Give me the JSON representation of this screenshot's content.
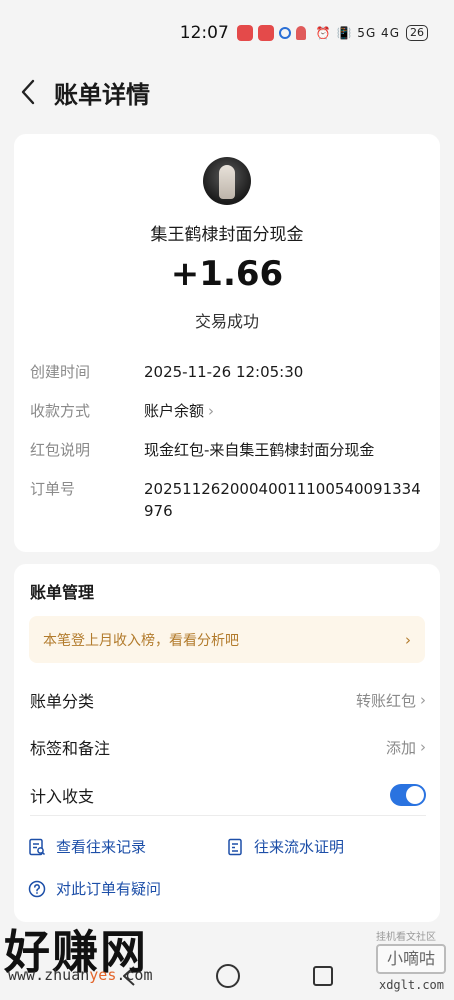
{
  "status_bar": {
    "time": "12:07",
    "indicators": "⏰ 📳 5G 4G",
    "battery": "26"
  },
  "header": {
    "title": "账单详情"
  },
  "transaction": {
    "payer_name": "集王鹤棣封面分现金",
    "amount": "+1.66",
    "status": "交易成功",
    "details": [
      {
        "label": "创建时间",
        "value": "2025-11-26 12:05:30"
      },
      {
        "label": "收款方式",
        "value": "账户余额"
      },
      {
        "label": "红包说明",
        "value": "现金红包-来自集王鹤棣封面分现金"
      },
      {
        "label": "订单号",
        "value": "20251126200040011100540091334976"
      }
    ]
  },
  "management": {
    "title": "账单管理",
    "promo_text": "本笔登上月收入榜，看看分析吧",
    "rows": [
      {
        "label": "账单分类",
        "value": "转账红包"
      },
      {
        "label": "标签和备注",
        "value": "添加"
      },
      {
        "label": "计入收支",
        "value": ""
      }
    ],
    "toggle_on": true,
    "links": {
      "history": "查看往来记录",
      "proof": "往来流水证明",
      "question": "对此订单有疑问"
    }
  },
  "watermarks": {
    "left_brand": "好赚网",
    "left_url_prefix": "www.zhuan",
    "left_url_highlight": "yes",
    "left_url_suffix": ".com",
    "right_tag": "挂机看文社区",
    "right_brand": "小嘀咕",
    "right_domain": "xdglt.com"
  },
  "icons": {
    "back": "chevron-left-icon",
    "chevron": "chevron-right-icon",
    "history": "receipt-search-icon",
    "proof": "document-icon",
    "question": "question-circle-icon"
  },
  "colors": {
    "accent_blue": "#2a73e0",
    "link_blue": "#1d4fa8",
    "promo_text": "#b27b2c",
    "promo_bg": "#fdf6ea"
  }
}
